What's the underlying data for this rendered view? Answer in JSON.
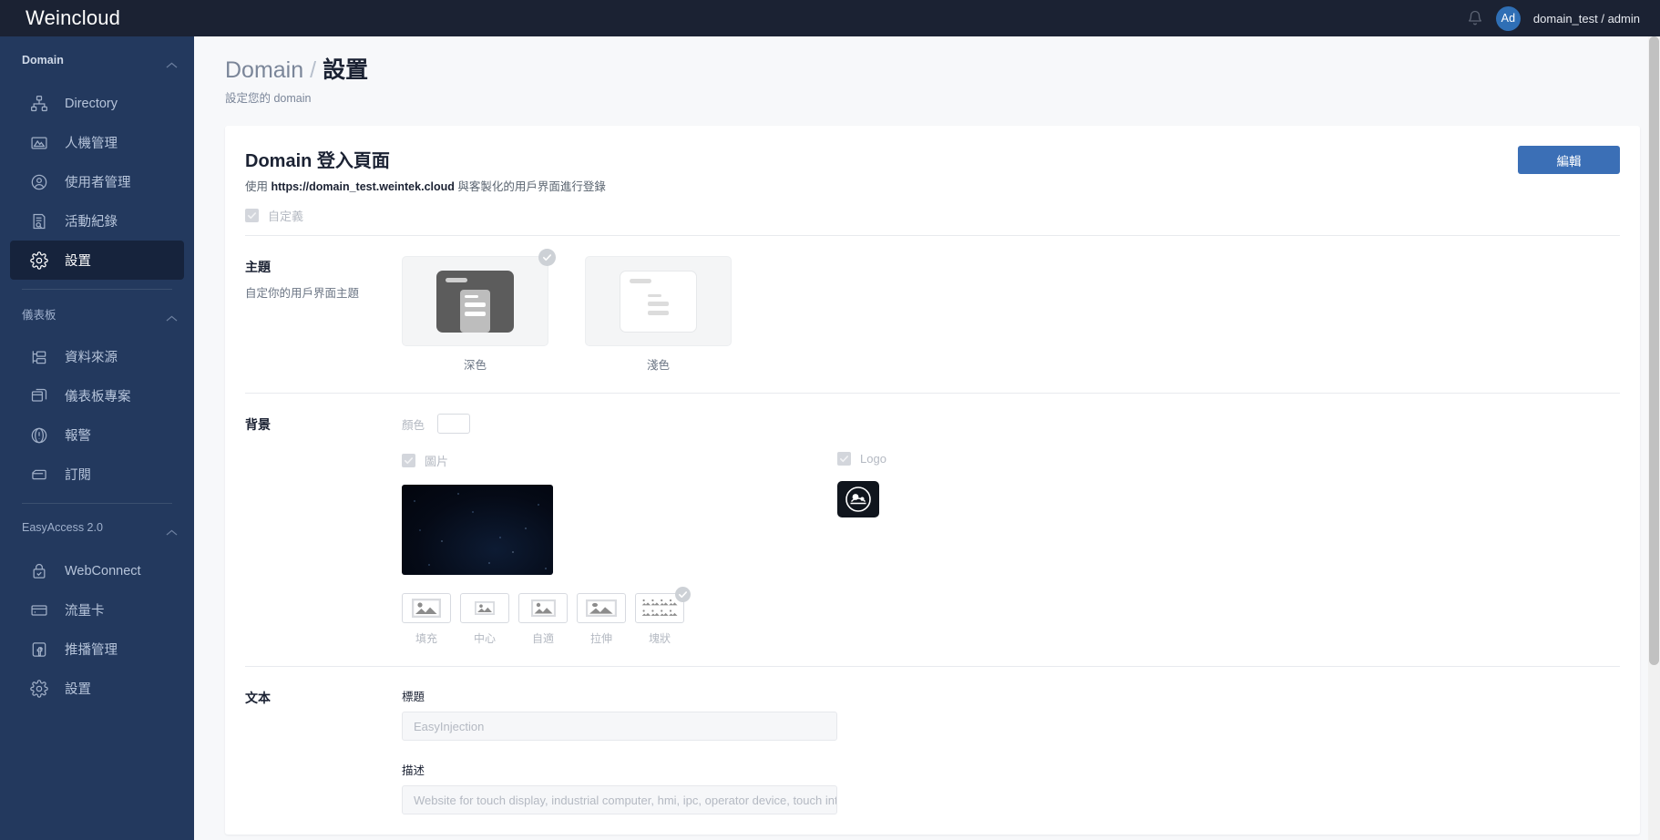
{
  "topbar": {
    "brand": "Weincloud",
    "bell_icon": "bell-icon",
    "avatar_initials": "Ad",
    "user_label": "domain_test / admin"
  },
  "sidebar": {
    "groups": [
      {
        "title": "Domain",
        "collapse_icon": "chevron-up-icon",
        "items": [
          {
            "label": "Directory",
            "icon": "directory-icon",
            "active": false
          },
          {
            "label": "人機管理",
            "icon": "hmi-icon",
            "active": false
          },
          {
            "label": "使用者管理",
            "icon": "user-circle-icon",
            "active": false
          },
          {
            "label": "活動紀錄",
            "icon": "activity-log-icon",
            "active": false
          },
          {
            "label": "設置",
            "icon": "gear-icon",
            "active": true
          }
        ]
      },
      {
        "title": "儀表板",
        "collapse_icon": "chevron-up-icon",
        "items": [
          {
            "label": "資料來源",
            "icon": "data-source-icon",
            "active": false
          },
          {
            "label": "儀表板專案",
            "icon": "dashboard-project-icon",
            "active": false
          },
          {
            "label": "報警",
            "icon": "alarm-icon",
            "active": false
          },
          {
            "label": "訂閱",
            "icon": "subscription-icon",
            "active": false
          }
        ]
      },
      {
        "title": "EasyAccess 2.0",
        "collapse_icon": "chevron-up-icon",
        "items": [
          {
            "label": "WebConnect",
            "icon": "lock-check-icon",
            "active": false
          },
          {
            "label": "流量卡",
            "icon": "data-card-icon",
            "active": false
          },
          {
            "label": "推播管理",
            "icon": "broadcast-icon",
            "active": false
          },
          {
            "label": "設置",
            "icon": "gear-icon",
            "active": false
          }
        ]
      }
    ]
  },
  "page": {
    "breadcrumb_parent": "Domain",
    "breadcrumb_sep": "/",
    "breadcrumb_current": "設置",
    "subtitle": "設定您的 domain"
  },
  "card": {
    "title": "Domain 登入頁面",
    "desc_prefix": "使用 ",
    "desc_url": "https://domain_test.weintek.cloud",
    "desc_suffix": " 與客製化的用戶界面進行登錄",
    "edit_button": "編輯",
    "custom_checkbox": {
      "label": "自定義",
      "checked": true,
      "disabled": true,
      "icon": "check-icon"
    }
  },
  "theme_section": {
    "label": "主題",
    "sublabel": "自定你的用戶界面主題",
    "options": [
      {
        "caption": "深色",
        "value": "dark",
        "selected": true,
        "badge_icon": "check-icon"
      },
      {
        "caption": "淺色",
        "value": "light",
        "selected": false
      }
    ]
  },
  "background_section": {
    "label": "背景",
    "color": {
      "label": "顏色",
      "value": "#ffffff",
      "swatch_name": "color-swatch"
    },
    "image": {
      "label": "圖片",
      "checked": true,
      "disabled": true,
      "preview_name": "background-image-preview"
    },
    "logo": {
      "label": "Logo",
      "checked": true,
      "disabled": true,
      "preview_name": "logo-preview"
    },
    "fill_modes": [
      {
        "caption": "填充",
        "value": "fill",
        "selected": false,
        "icon": "image-fill-icon"
      },
      {
        "caption": "中心",
        "value": "center",
        "selected": false,
        "icon": "image-center-icon"
      },
      {
        "caption": "自適",
        "value": "fit",
        "selected": false,
        "icon": "image-fit-icon"
      },
      {
        "caption": "拉伸",
        "value": "stretch",
        "selected": false,
        "icon": "image-stretch-icon"
      },
      {
        "caption": "塊狀",
        "value": "tile",
        "selected": true,
        "icon": "image-tile-icon",
        "badge_icon": "check-icon"
      }
    ]
  },
  "text_section": {
    "label": "文本",
    "title_field": {
      "label": "標題",
      "value": "",
      "placeholder": "EasyInjection"
    },
    "desc_field": {
      "label": "描述",
      "value": "",
      "placeholder": "Website for touch display, industrial computer, hmi, ipc, operator device, touch int…"
    }
  },
  "colors": {
    "topbar_bg": "#1b2233",
    "sidebar_bg": "#23395e",
    "sidebar_active_bg": "#16233c",
    "accent": "#3b6fb6",
    "page_bg": "#f7f8fa"
  }
}
